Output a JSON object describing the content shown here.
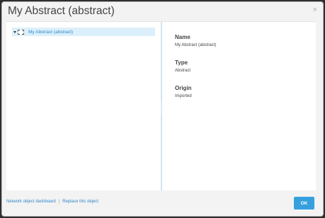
{
  "dialog": {
    "title": "My Abstract (abstract)",
    "close_glyph": "×"
  },
  "tree": {
    "items": [
      {
        "label": "My Abstract (abstract)",
        "icon": "abstract-dashed-box-icon",
        "expanded": true,
        "selected": true
      }
    ]
  },
  "details": {
    "name_label": "Name",
    "name_value": "My Abstract (abstract)",
    "type_label": "Type",
    "type_value": "Abstract",
    "origin_label": "Origin",
    "origin_value": "Imported"
  },
  "footer": {
    "link_dashboard": "Network object dashboard",
    "separator": "|",
    "link_replace": "Replace this object",
    "ok_label": "OK"
  },
  "colors": {
    "accent": "#36a0df",
    "link": "#2f86c9",
    "selection": "#dcf0fb"
  }
}
